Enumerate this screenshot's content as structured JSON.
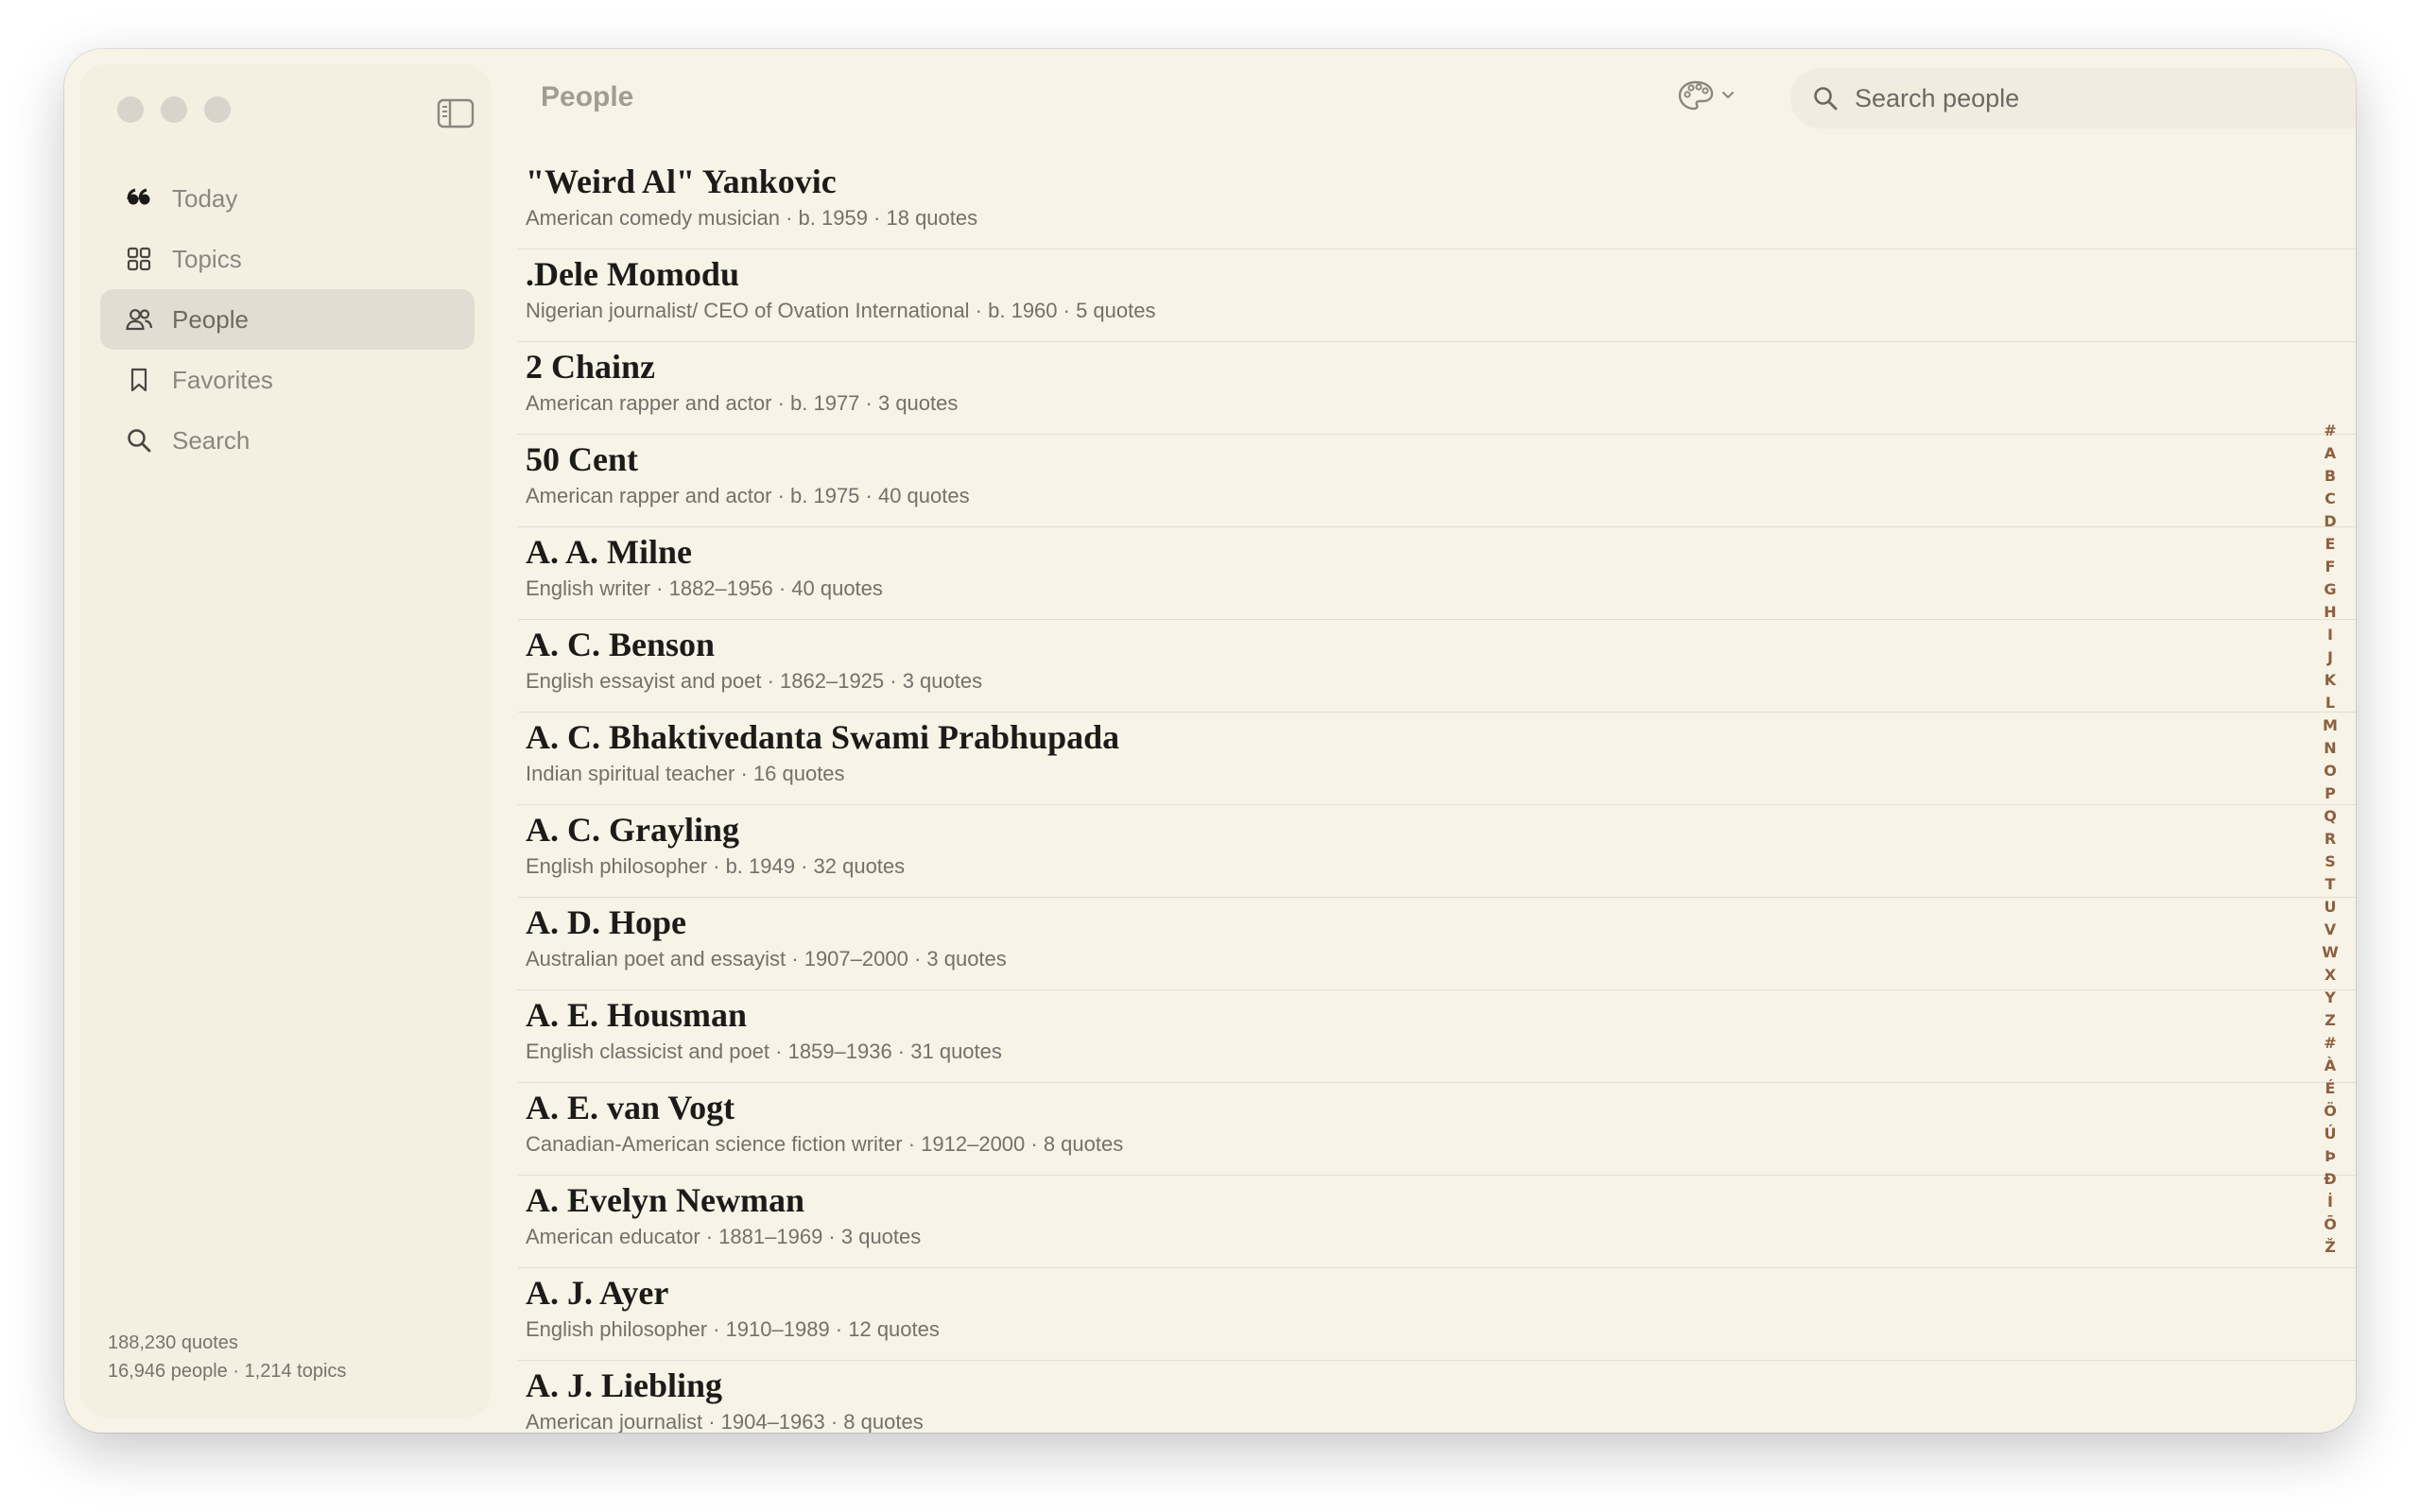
{
  "window": {
    "title": "People"
  },
  "sidebar": {
    "items": [
      {
        "label": "Today",
        "icon": "quote-icon",
        "active": false
      },
      {
        "label": "Topics",
        "icon": "grid-icon",
        "active": false
      },
      {
        "label": "People",
        "icon": "people-icon",
        "active": true
      },
      {
        "label": "Favorites",
        "icon": "bookmark-icon",
        "active": false
      },
      {
        "label": "Search",
        "icon": "search-icon",
        "active": false
      }
    ],
    "stats_line1": "188,230 quotes",
    "stats_line2": "16,946 people · 1,214 topics"
  },
  "header": {
    "title": "People",
    "theme_icon": "palette-icon",
    "search_placeholder": "Search people"
  },
  "people": [
    {
      "name": "\"Weird Al\" Yankovic",
      "meta": "American comedy musician · b. 1959 · 18 quotes"
    },
    {
      "name": ".Dele Momodu",
      "meta": "Nigerian journalist/ CEO of Ovation International · b. 1960 · 5 quotes"
    },
    {
      "name": "2 Chainz",
      "meta": "American rapper and actor · b. 1977 · 3 quotes"
    },
    {
      "name": "50 Cent",
      "meta": "American rapper and actor · b. 1975 · 40 quotes"
    },
    {
      "name": "A. A. Milne",
      "meta": "English writer · 1882–1956 · 40 quotes"
    },
    {
      "name": "A. C. Benson",
      "meta": "English essayist and poet · 1862–1925 · 3 quotes"
    },
    {
      "name": "A. C. Bhaktivedanta Swami Prabhupada",
      "meta": "Indian spiritual teacher · 16 quotes"
    },
    {
      "name": "A. C. Grayling",
      "meta": "English philosopher · b. 1949 · 32 quotes"
    },
    {
      "name": "A. D. Hope",
      "meta": "Australian poet and essayist · 1907–2000 · 3 quotes"
    },
    {
      "name": "A. E. Housman",
      "meta": "English classicist and poet · 1859–1936 · 31 quotes"
    },
    {
      "name": "A. E. van Vogt",
      "meta": "Canadian-American science fiction writer · 1912–2000 · 8 quotes"
    },
    {
      "name": "A. Evelyn Newman",
      "meta": "American educator · 1881–1969 · 3 quotes"
    },
    {
      "name": "A. J. Ayer",
      "meta": "English philosopher · 1910–1989 · 12 quotes"
    },
    {
      "name": "A. J. Liebling",
      "meta": "American journalist · 1904–1963 · 8 quotes"
    }
  ],
  "alphabet_index": [
    "#",
    "A",
    "B",
    "C",
    "D",
    "E",
    "F",
    "G",
    "H",
    "I",
    "J",
    "K",
    "L",
    "M",
    "N",
    "O",
    "P",
    "Q",
    "R",
    "S",
    "T",
    "U",
    "V",
    "W",
    "X",
    "Y",
    "Z",
    "#",
    "À",
    "É",
    "Ö",
    "Ú",
    "Þ",
    "Ð",
    "İ",
    "Ō",
    "Ž"
  ],
  "colors": {
    "window_bg": "#f8f3e7",
    "sidebar_active": "#e2ddd3",
    "index_letters": "#8c6040"
  }
}
